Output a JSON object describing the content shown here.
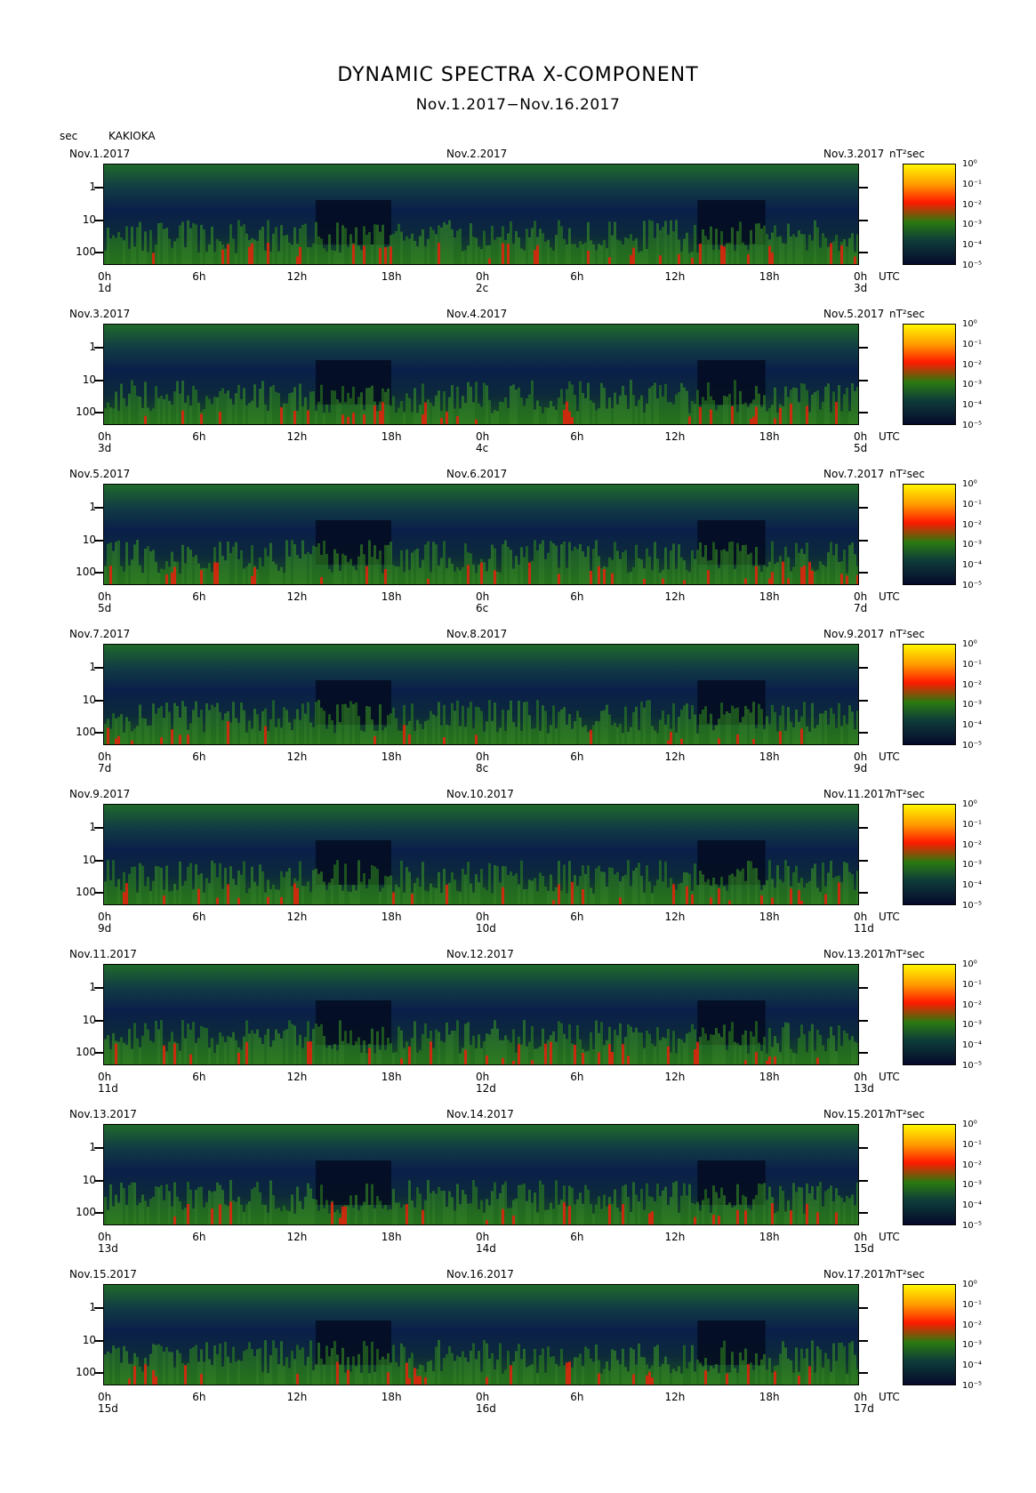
{
  "title": "DYNAMIC SPECTRA X-COMPONENT",
  "subtitle": "Nov.1.2017−Nov.16.2017",
  "y_unit_label": "sec",
  "station": "KAKIOKA",
  "colorbar_unit": "nT²sec",
  "x_unit": "UTC",
  "chart_data": {
    "type": "heatmap",
    "title": "DYNAMIC SPECTRA X-COMPONENT",
    "subtitle": "Nov.1.2017−Nov.16.2017",
    "ylabel": "sec",
    "y_ticks": [
      "1",
      "10",
      "100"
    ],
    "y_scale": "log",
    "x_ticks": [
      "0h",
      "6h",
      "12h",
      "18h",
      "0h",
      "6h",
      "12h",
      "18h",
      "0h"
    ],
    "colorbar_ticks": [
      "10⁰",
      "10⁻¹",
      "10⁻²",
      "10⁻³",
      "10⁻⁴",
      "10⁻⁵"
    ],
    "colorbar_label": "nT²sec",
    "colors": [
      "#fff700",
      "#ff9a00",
      "#ff1a00",
      "#2a7a10",
      "#0e3d3a",
      "#050a2a"
    ],
    "panels": [
      {
        "start": "Nov.1.2017",
        "mid": "Nov.2.2017",
        "end": "Nov.3.2017",
        "day_left": "1d",
        "day_mid": "2c",
        "day_right": "3d"
      },
      {
        "start": "Nov.3.2017",
        "mid": "Nov.4.2017",
        "end": "Nov.5.2017",
        "day_left": "3d",
        "day_mid": "4c",
        "day_right": "5d"
      },
      {
        "start": "Nov.5.2017",
        "mid": "Nov.6.2017",
        "end": "Nov.7.2017",
        "day_left": "5d",
        "day_mid": "6c",
        "day_right": "7d"
      },
      {
        "start": "Nov.7.2017",
        "mid": "Nov.8.2017",
        "end": "Nov.9.2017",
        "day_left": "7d",
        "day_mid": "8c",
        "day_right": "9d"
      },
      {
        "start": "Nov.9.2017",
        "mid": "Nov.10.2017",
        "end": "Nov.11.2017",
        "day_left": "9d",
        "day_mid": "10d",
        "day_right": "11d"
      },
      {
        "start": "Nov.11.2017",
        "mid": "Nov.12.2017",
        "end": "Nov.13.2017",
        "day_left": "11d",
        "day_mid": "12d",
        "day_right": "13d"
      },
      {
        "start": "Nov.13.2017",
        "mid": "Nov.14.2017",
        "end": "Nov.15.2017",
        "day_left": "13d",
        "day_mid": "14d",
        "day_right": "15d"
      },
      {
        "start": "Nov.15.2017",
        "mid": "Nov.16.2017",
        "end": "Nov.17.2017",
        "day_left": "15d",
        "day_mid": "16d",
        "day_right": "17d"
      }
    ]
  }
}
